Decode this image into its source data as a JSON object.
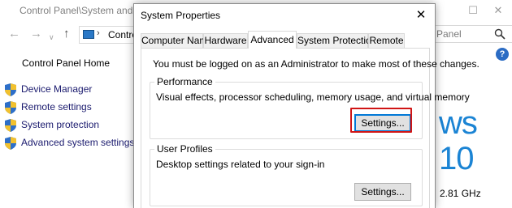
{
  "control_panel": {
    "title": "Control Panel\\System and Se",
    "address_text": "Contro",
    "search_placeholder": "Panel",
    "home_link": "Control Panel Home",
    "sidebar": [
      {
        "label": "Device Manager",
        "icon": "uac-shield-icon"
      },
      {
        "label": "Remote settings",
        "icon": "uac-shield-icon"
      },
      {
        "label": "System protection",
        "icon": "uac-shield-icon"
      },
      {
        "label": "Advanced system settings",
        "icon": "uac-shield-icon"
      }
    ],
    "help_glyph": "?",
    "windows_brand_fragment": "ws 10",
    "processor_speed": "2.81 GHz",
    "brand_color": "#1b84d4"
  },
  "dialog": {
    "title": "System Properties",
    "close_glyph": "✕",
    "tabs": [
      {
        "label": "Computer Name",
        "active": false
      },
      {
        "label": "Hardware",
        "active": false
      },
      {
        "label": "Advanced",
        "active": true
      },
      {
        "label": "System Protection",
        "active": false
      },
      {
        "label": "Remote",
        "active": false
      }
    ],
    "admin_note": "You must be logged on as an Administrator to make most of these changes.",
    "performance": {
      "title": "Performance",
      "description": "Visual effects, processor scheduling, memory usage, and virtual memory",
      "button_label": "Settings..."
    },
    "user_profiles": {
      "title": "User Profiles",
      "description": "Desktop settings related to your sign-in",
      "button_label": "Settings..."
    },
    "highlight_color": "#d01515",
    "focus_color": "#0078d7"
  }
}
